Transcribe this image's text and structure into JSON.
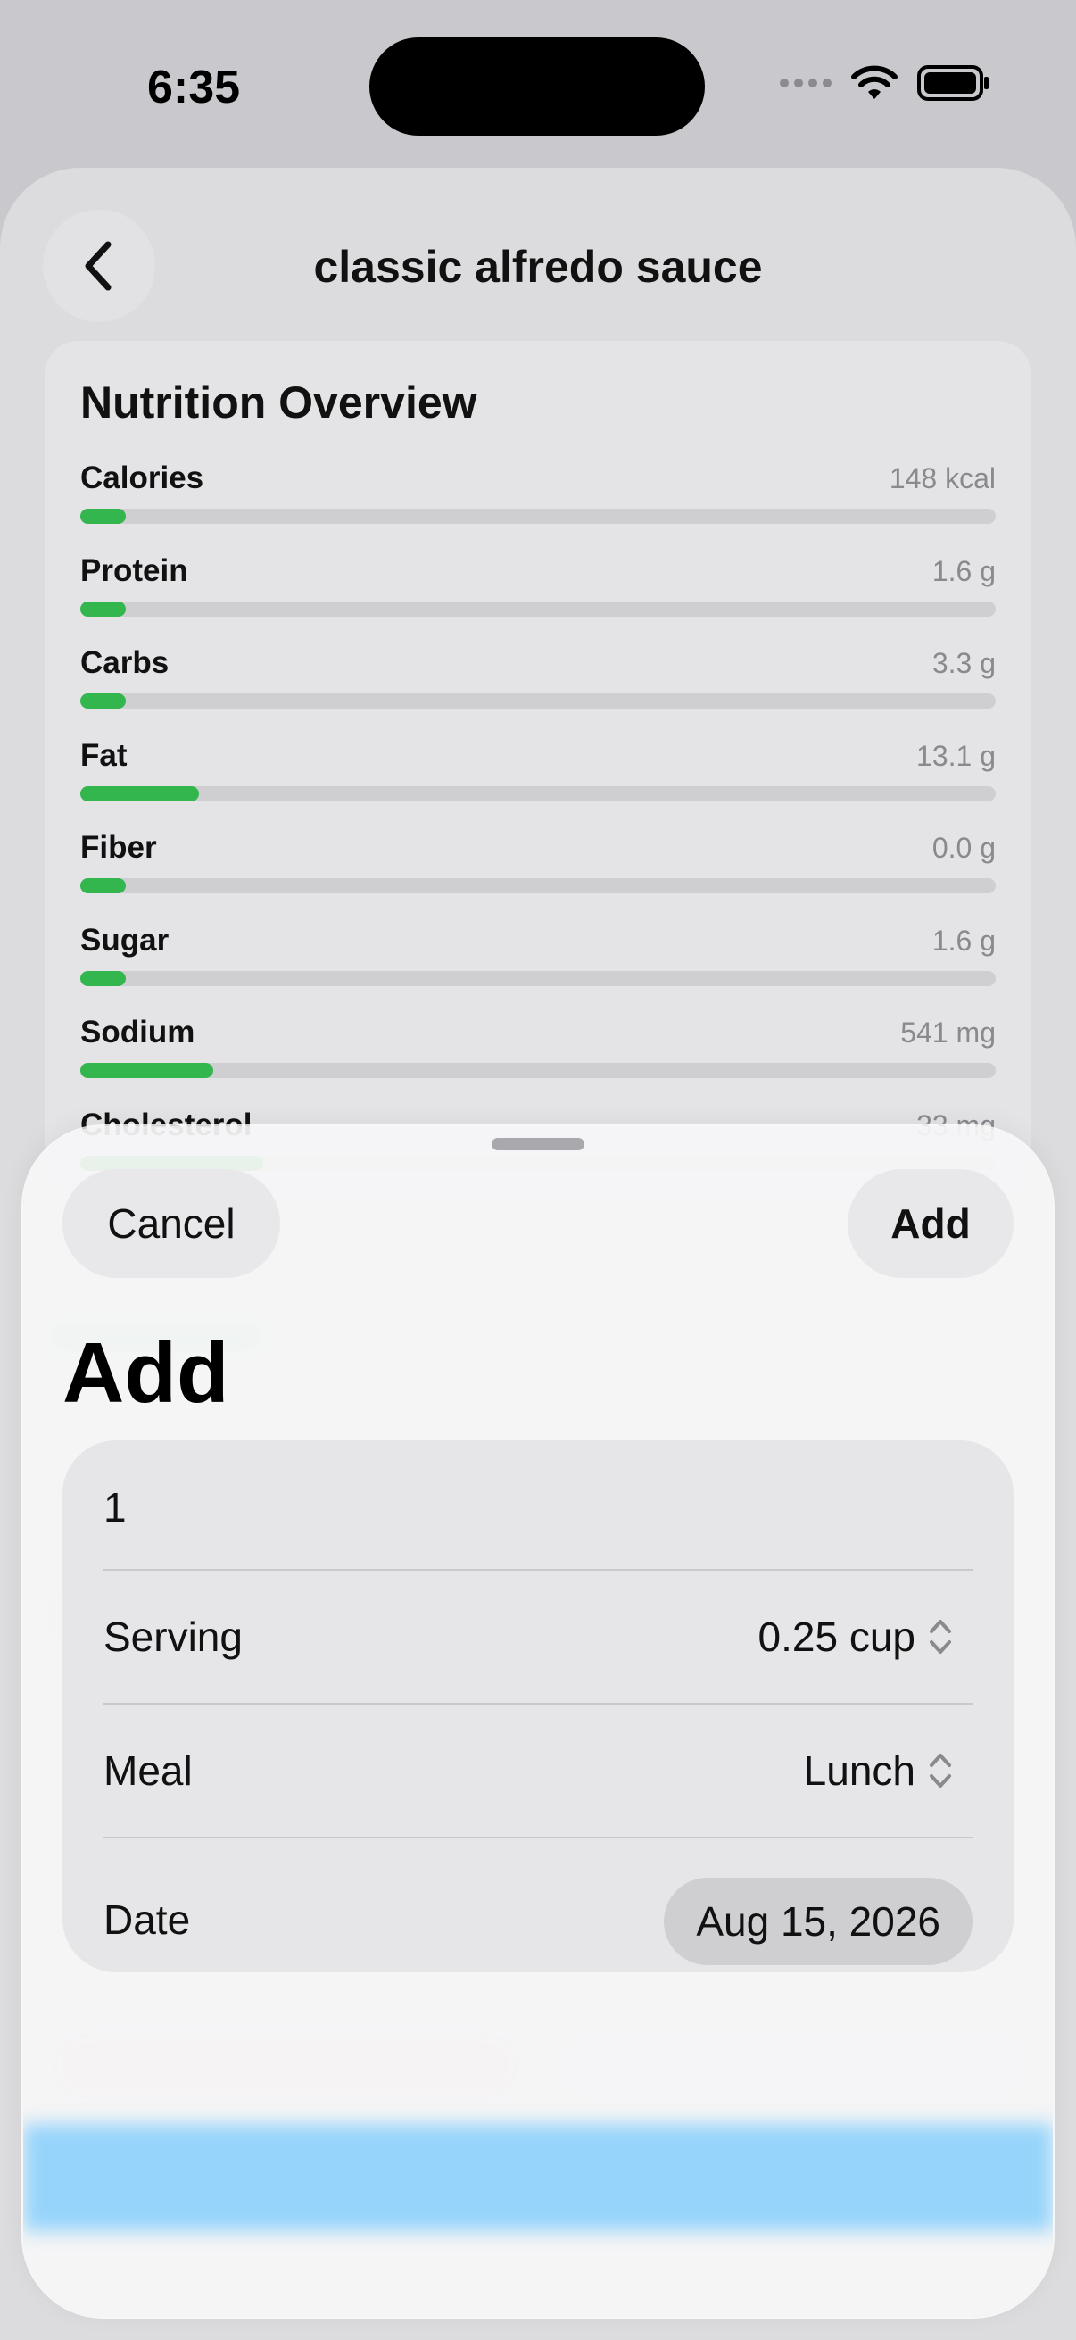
{
  "status": {
    "time": "6:35"
  },
  "header": {
    "title": "classic alfredo sauce"
  },
  "nutrition": {
    "title": "Nutrition Overview",
    "items": [
      {
        "label": "Calories",
        "value": "148 kcal",
        "progress": 0.05
      },
      {
        "label": "Protein",
        "value": "1.6 g",
        "progress": 0.05
      },
      {
        "label": "Carbs",
        "value": "3.3 g",
        "progress": 0.05
      },
      {
        "label": "Fat",
        "value": "13.1 g",
        "progress": 0.13
      },
      {
        "label": "Fiber",
        "value": "0.0 g",
        "progress": 0.05
      },
      {
        "label": "Sugar",
        "value": "1.6 g",
        "progress": 0.05
      },
      {
        "label": "Sodium",
        "value": "541 mg",
        "progress": 0.145
      },
      {
        "label": "Cholesterol",
        "value": "33 mg",
        "progress": 0.2
      }
    ]
  },
  "sheet": {
    "cancel_label": "Cancel",
    "add_label": "Add",
    "title": "Add",
    "quantity": "1",
    "serving_label": "Serving",
    "serving_value": "0.25 cup",
    "meal_label": "Meal",
    "meal_value": "Lunch",
    "date_label": "Date",
    "date_value": "Aug 15, 2026"
  },
  "colors": {
    "accent_green": "#34b64f",
    "highlight_blue": "#96d4fb"
  },
  "icons": [
    "back-chevron-icon",
    "wifi-icon",
    "battery-icon",
    "up-down-chevron-icon"
  ]
}
